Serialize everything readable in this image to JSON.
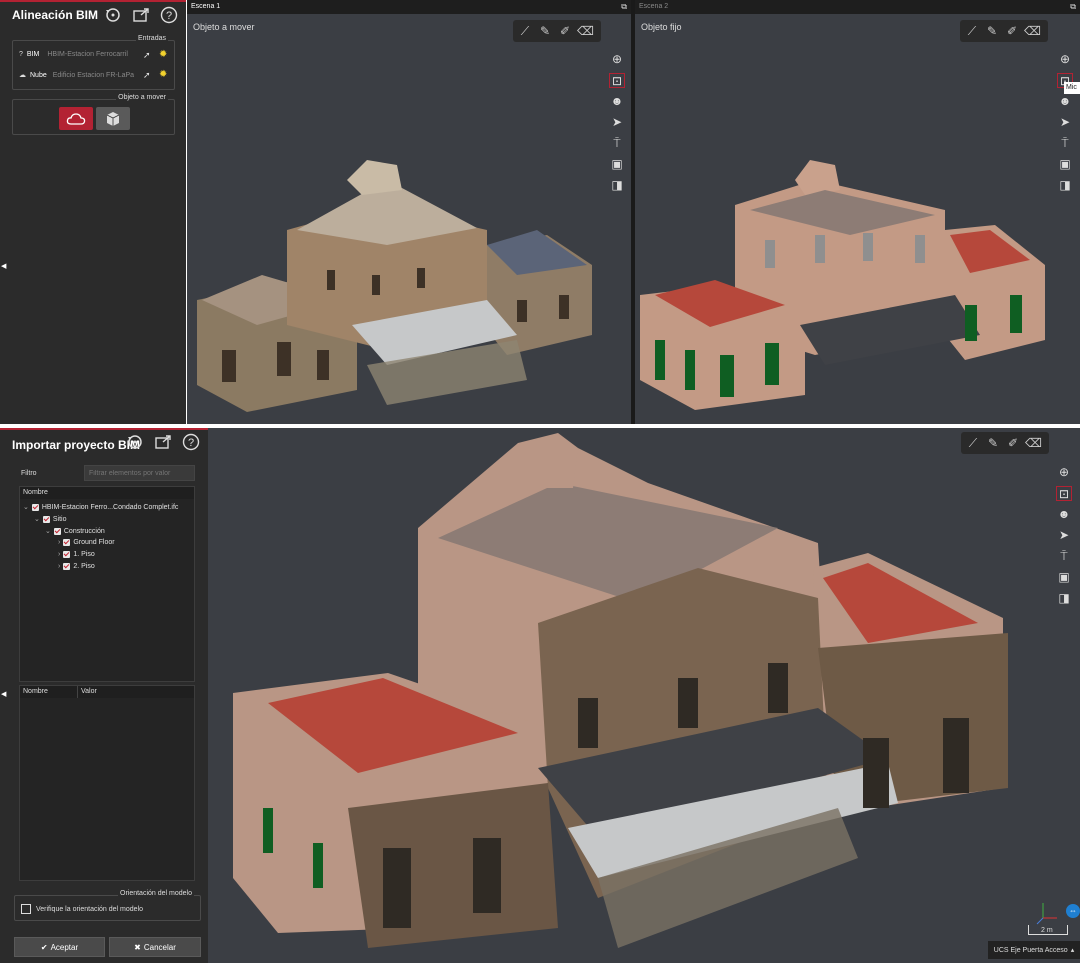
{
  "top_panel": {
    "title": "Alineación BIM",
    "entradas_title": "Entradas",
    "bim_label": "BIM",
    "bim_value": "HBIM-Estacion Ferrocarril",
    "nube_label": "Nube",
    "nube_value": "Edificio Estacion FR-LaPa",
    "objeto_title": "Objeto a mover"
  },
  "scene1": {
    "tab": "Escena 1",
    "label": "Objeto a mover"
  },
  "scene2": {
    "tab": "Escena 2",
    "label": "Objeto fijo",
    "tooltip": "Mic"
  },
  "bottom_panel": {
    "title": "Importar proyecto BIM",
    "filter_label": "Filtro",
    "filter_placeholder": "Filtrar elementos por valor",
    "tree_header": "Nombre",
    "tree_items": [
      {
        "label": "HBIM-Estacion Ferro...Condado Complet.ifc"
      },
      {
        "label": "Sitio"
      },
      {
        "label": "Construcción"
      },
      {
        "label": "Ground Floor"
      },
      {
        "label": "1. Piso"
      },
      {
        "label": "2. Piso"
      }
    ],
    "props_col_name": "Nombre",
    "props_col_value": "Valor",
    "orient_title": "Orientación del modelo",
    "orient_checkbox": "Verifique la orientación del modelo",
    "accept": "Aceptar",
    "cancel": "Cancelar"
  },
  "main_view": {
    "scale_label": "2 m",
    "ucs_label": "UCS Eje Puerta Acceso"
  },
  "colors": {
    "accent": "#b32233",
    "panel": "#2b2b2b",
    "viewport": "#3b3e44"
  }
}
